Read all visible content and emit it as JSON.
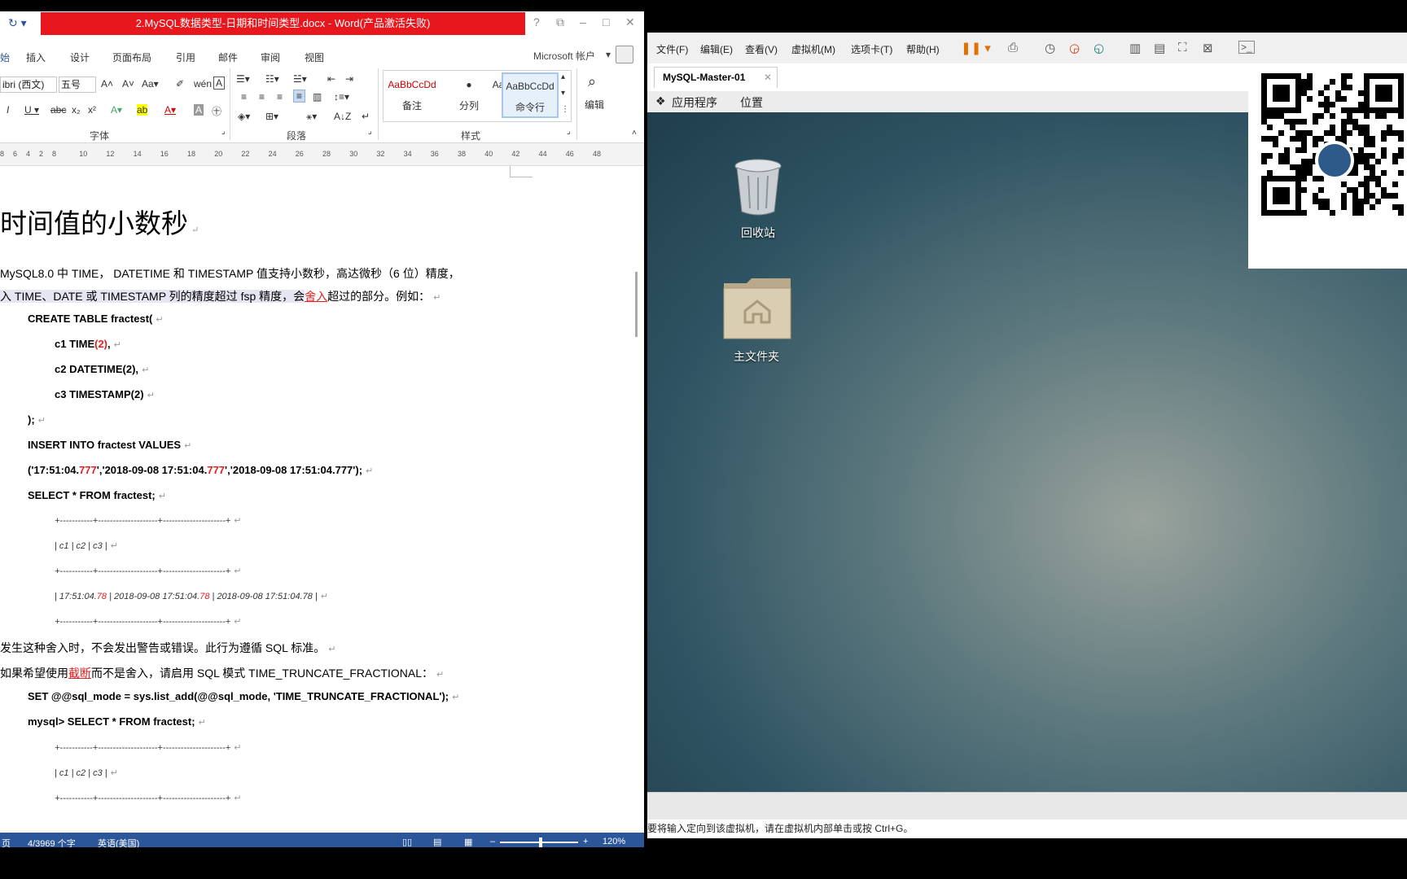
{
  "word": {
    "title": "2.MySQL数据类型-日期和时间类型.docx - Word(产品激活失败)",
    "help": "?",
    "tabs": [
      "插入",
      "设计",
      "页面布局",
      "引用",
      "邮件",
      "审阅",
      "视图"
    ],
    "account": "Microsoft 帐户",
    "ribbon": {
      "font_name": "ibri (西文)",
      "font_size": "五号",
      "group_font": "字体",
      "group_paragraph": "段落",
      "group_styles": "样式",
      "styles": [
        {
          "sample": "AaBbCcDd",
          "name": "备注"
        },
        {
          "sample": "●",
          "name": "分列"
        },
        {
          "sample": "AaB",
          "name": "命令行"
        },
        {
          "sample": "AaBbCcDd",
          "name": ""
        }
      ],
      "edit_label": "编辑"
    },
    "ruler_ticks": [
      "8",
      "6",
      "4",
      "2",
      "8",
      "10",
      "12",
      "14",
      "16",
      "18",
      "20",
      "22",
      "24",
      "26",
      "28",
      "30",
      "32",
      "34",
      "36",
      "38",
      "40",
      "42",
      "44",
      "46",
      "48"
    ],
    "doc": {
      "heading": "时间值的小数秒",
      "para1": "MySQL8.0 中 TIME，  DATETIME 和  TIMESTAMP 值支持小数秒，高达微秒（6 位）精度，",
      "para2_a": "入 TIME、DATE 或 TIMESTAMP 列的精度超过 fsp 精度，会",
      "para2_link": "舍入",
      "para2_b": "超过的部分。例如：",
      "code1": "CREATE TABLE fractest(",
      "code2_a": "c1 TIME",
      "code2_red": "(2)",
      "code2_b": ",",
      "code3": "c2 DATETIME(2),",
      "code4": "c3 TIMESTAMP(2)",
      "code5": ");",
      "code6": "INSERT INTO fractest VALUES",
      "code7_a": "('17:51:04.",
      "code7_r1": "777",
      "code7_b": "','2018-09-08 17:51:04.",
      "code7_r2": "777",
      "code7_c": "','2018-09-08 17:51:04.777');",
      "code8": "SELECT * FROM fractest;",
      "tbl_border": "+-----------+--------------------+---------------------+",
      "tbl_head": "| c1              | c2                          | c3                           |",
      "tbl_row_a": "| 17:51:04.",
      "tbl_row_r1": "78",
      "tbl_row_b": " | 2018-09-08 17:51:04.",
      "tbl_row_r2": "78",
      "tbl_row_c": " | 2018-09-08 17:51:04.78 |",
      "para3": "发生这种舍入时，不会发出警告或错误。此行为遵循 SQL 标准。",
      "para4_a": "如果希望使用",
      "para4_link": "截断",
      "para4_b": "而不是舍入，请启用  SQL 模式 TIME_TRUNCATE_FRACTIONAL：",
      "code9": "SET @@sql_mode = sys.list_add(@@sql_mode, 'TIME_TRUNCATE_FRACTIONAL');",
      "code10": "mysql> SELECT * FROM fractest;",
      "mark": "↵"
    },
    "status": {
      "page": "页",
      "words": "4/3969 个字",
      "lang": "英语(美国)",
      "zoom": "120%"
    }
  },
  "vm": {
    "menu": [
      "文件(F)",
      "编辑(E)",
      "查看(V)",
      "虚拟机(M)",
      "选项卡(T)",
      "帮助(H)"
    ],
    "tab_title": "MySQL-Master-01",
    "gnome": [
      "应用程序",
      "位置"
    ],
    "icons": [
      {
        "label": "回收站",
        "icon": "trash-icon"
      },
      {
        "label": "主文件夹",
        "icon": "home-folder-icon"
      }
    ],
    "hint": "要将输入定向到该虚拟机，请在虚拟机内部单击或按 Ctrl+G。"
  }
}
